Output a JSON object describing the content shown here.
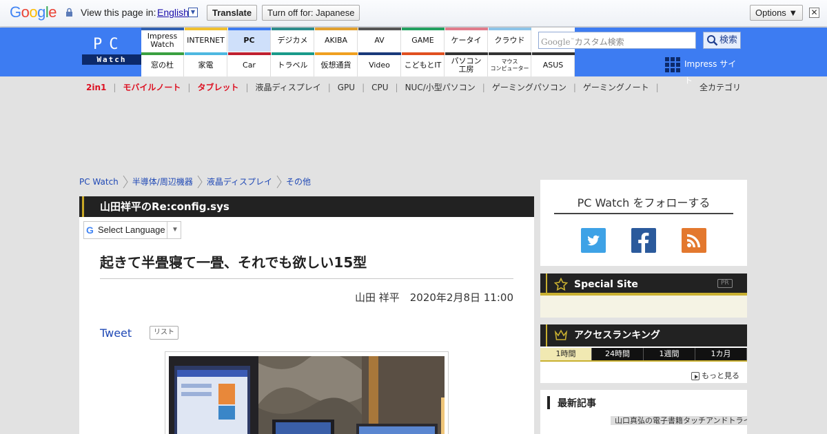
{
  "translate_bar": {
    "logo": "Google",
    "view_text": "View this page in:",
    "language": "English",
    "translate_label": "Translate",
    "turnoff_label": "Turn off for: Japanese",
    "options_label": "Options ▼",
    "close_symbol": "✕"
  },
  "header": {
    "logo_top": "PC",
    "logo_bottom": "Watch",
    "nav_top": [
      {
        "label": "Impress\nWatch",
        "color": "#2f5fb0"
      },
      {
        "label": "INTERNET",
        "color": "#f0c030"
      },
      {
        "label": "PC",
        "color": "#3d7cf2"
      },
      {
        "label": "デジカメ",
        "color": "#2c8c8c"
      },
      {
        "label": "AKIBA",
        "color": "#e0a030"
      },
      {
        "label": "AV",
        "color": "#555555"
      },
      {
        "label": "GAME",
        "color": "#22a060"
      },
      {
        "label": "ケータイ",
        "color": "#e07c8c"
      },
      {
        "label": "クラウド",
        "color": "#8cc4e8"
      }
    ],
    "nav_bottom": [
      {
        "label": "窓の杜",
        "color": "#3aa040"
      },
      {
        "label": "家電",
        "color": "#4eb8e0"
      },
      {
        "label": "Car",
        "color": "#c02030"
      },
      {
        "label": "トラベル",
        "color": "#1a9a8a"
      },
      {
        "label": "仮想通貨",
        "color": "#f0a020"
      },
      {
        "label": "Video",
        "color": "#1a3a7a"
      },
      {
        "label": "こどもとIT",
        "color": "#e05020"
      },
      {
        "label": "パソコン\n工房",
        "color": "#333333"
      },
      {
        "label": "マウス\nコンピューター",
        "color": "#333333"
      },
      {
        "label": "ASUS",
        "color": "#333333"
      }
    ],
    "search_placeholder": "カスタム検索",
    "search_google": "Google",
    "search_button": "検索",
    "impress_site": "Impress サイト"
  },
  "subcats": [
    "2in1",
    "モバイルノート",
    "タブレット",
    "液晶ディスプレイ",
    "GPU",
    "CPU",
    "NUC/小型パソコン",
    "ゲーミングパソコン",
    "ゲーミングノート"
  ],
  "all_categories": "全カテゴリ",
  "breadcrumb": [
    "PC Watch",
    "半導体/周辺機器",
    "液晶ディスプレイ",
    "その他"
  ],
  "article": {
    "series": "山田祥平のRe:config.sys",
    "select_language": "Select Language",
    "title": "起きて半畳寝て一畳、それでも欲しい15型",
    "author": "山田 祥平",
    "date": "2020年2月8日 11:00",
    "tweet": "Tweet",
    "list_badge": "リスト"
  },
  "sidebar": {
    "follow_title": "PC Watch をフォローする",
    "special_site": "Special Site",
    "pr": "PR",
    "ranking_title": "アクセスランキング",
    "ranking_tabs": [
      "1時間",
      "24時間",
      "1週間",
      "1カ月"
    ],
    "more": "もっと見る",
    "latest_title": "最新記事",
    "latest_item": "山口真弘の電子書籍タッチアンドトライ"
  },
  "colors": {
    "header_blue": "#3d7cf2",
    "accent_gold": "#c9b030",
    "link_blue": "#1f48b5",
    "red_category": "#dd1122"
  }
}
